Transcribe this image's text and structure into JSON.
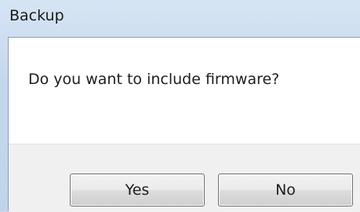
{
  "window": {
    "title": "Backup"
  },
  "dialog": {
    "message": "Do you want to include firmware?"
  },
  "buttons": {
    "yes_label": "Yes",
    "no_label": "No"
  }
}
